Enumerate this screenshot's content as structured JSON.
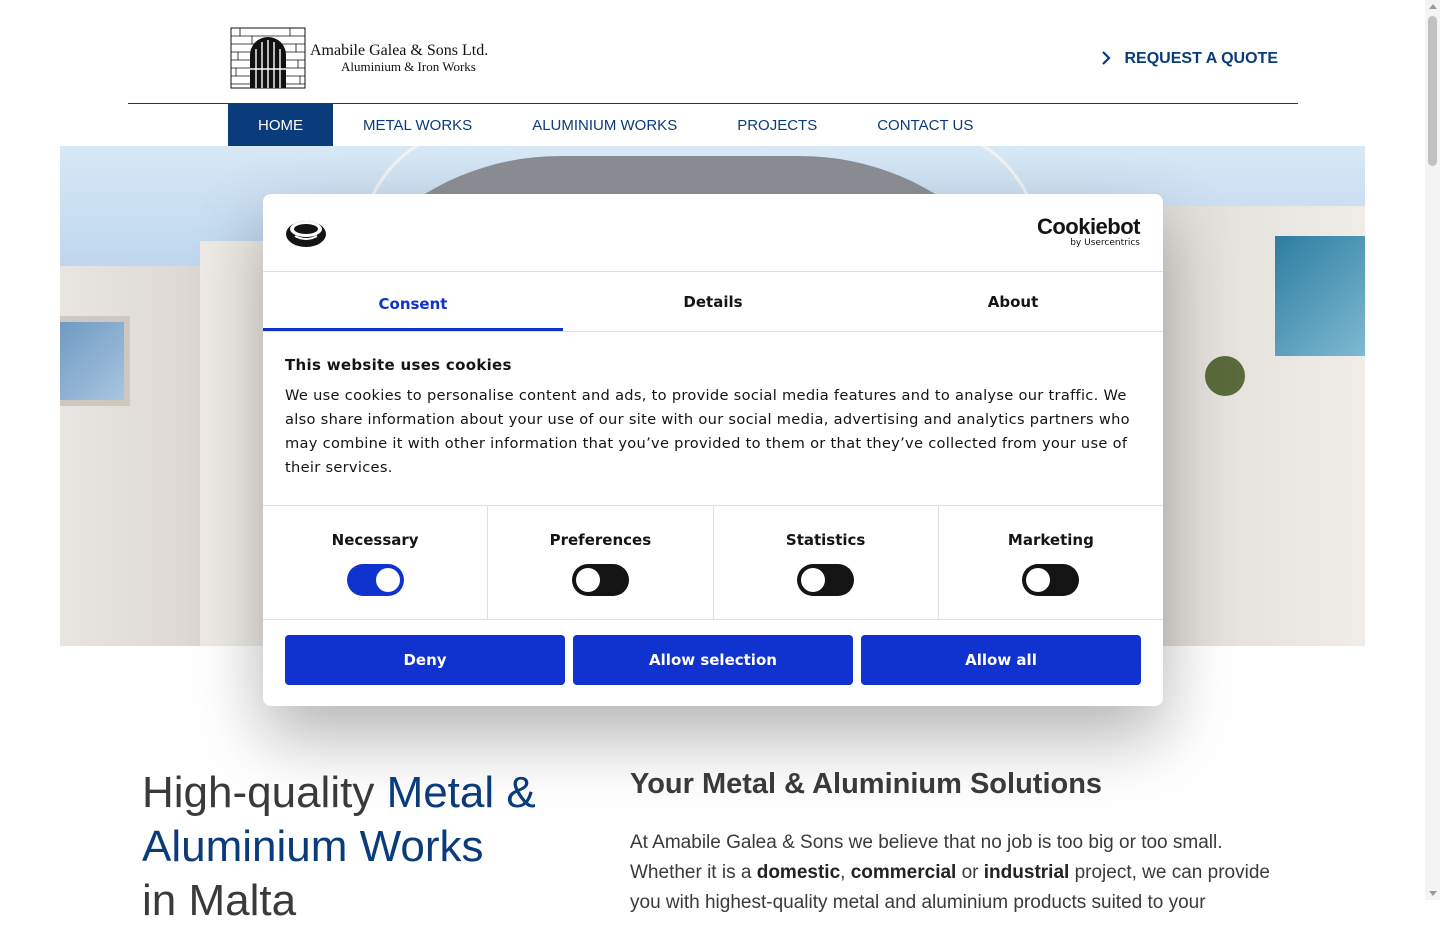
{
  "header": {
    "logo_line1": "Amabile Galea & Sons Ltd.",
    "logo_line2": "Aluminium & Iron Works",
    "request_quote": "REQUEST A QUOTE"
  },
  "nav": {
    "items": [
      {
        "label": "HOME",
        "active": true
      },
      {
        "label": "METAL WORKS"
      },
      {
        "label": "ALUMINIUM WORKS"
      },
      {
        "label": "PROJECTS"
      },
      {
        "label": "CONTACT US"
      }
    ]
  },
  "cookie": {
    "brand_name": "Cookiebot",
    "brand_sub": "by Usercentrics",
    "tabs": [
      {
        "label": "Consent",
        "active": true
      },
      {
        "label": "Details"
      },
      {
        "label": "About"
      }
    ],
    "title": "This website uses cookies",
    "text": "We use cookies to personalise content and ads, to provide social media features and to analyse our traffic. We also share information about your use of our site with our social media, advertising and analytics partners who may combine it with other information that you’ve provided to them or that they’ve collected from your use of their services.",
    "categories": [
      {
        "label": "Necessary",
        "checked": true
      },
      {
        "label": "Preferences",
        "checked": false
      },
      {
        "label": "Statistics",
        "checked": false
      },
      {
        "label": "Marketing",
        "checked": false
      }
    ],
    "buttons": {
      "deny": "Deny",
      "allow_selection": "Allow selection",
      "allow_all": "Allow all"
    },
    "accent_color": "#1032cf"
  },
  "content": {
    "headline_plain": "High-quality ",
    "headline_accent": "Metal & Aluminium Works",
    "headline_tail": "in Malta",
    "subheading": "Your Metal & Aluminium Solutions",
    "para_1": "At Amabile Galea & Sons we believe that no job is too big or too small. Whether it is a ",
    "para_bold_1": "domestic",
    "para_2": ", ",
    "para_bold_2": "commercial",
    "para_3": " or ",
    "para_bold_3": "industrial",
    "para_4": " project, we can provide you with highest-quality metal and aluminium products suited to your"
  },
  "colors": {
    "brand_blue": "#0a3b7a"
  }
}
